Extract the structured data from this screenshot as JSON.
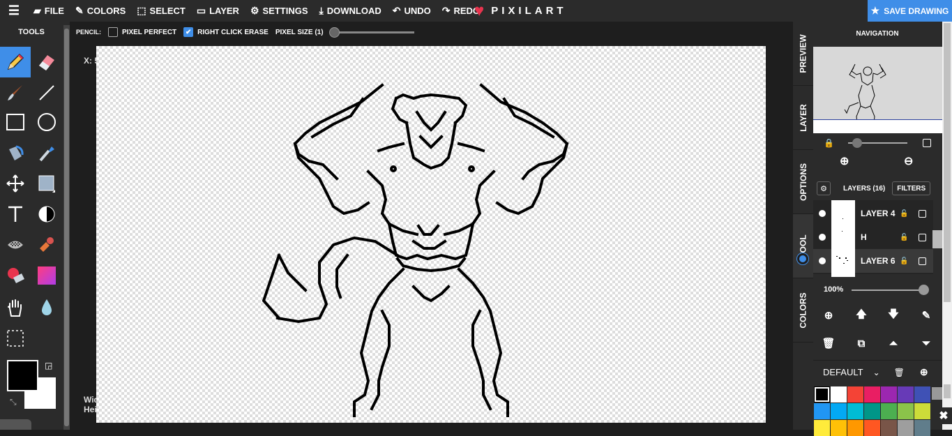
{
  "app": {
    "brand": "PIXILART",
    "menu": [
      {
        "label": "FILE",
        "icon": "file-icon"
      },
      {
        "label": "COLORS",
        "icon": "brush-icon"
      },
      {
        "label": "SELECT",
        "icon": "select-icon"
      },
      {
        "label": "LAYER",
        "icon": "layer-icon"
      },
      {
        "label": "SETTINGS",
        "icon": "gear-icon"
      },
      {
        "label": "DOWNLOAD",
        "icon": "download-icon"
      },
      {
        "label": "UNDO",
        "icon": "undo-icon"
      },
      {
        "label": "REDO",
        "icon": "redo-icon"
      }
    ],
    "save_label": "SAVE DRAWING"
  },
  "tools": {
    "title": "TOOLS",
    "items": [
      "pencil",
      "eraser",
      "brush",
      "line",
      "rectangle",
      "circle",
      "bucket",
      "eyedropper",
      "move",
      "shape-select",
      "text",
      "dither",
      "pattern",
      "stamp",
      "color-replace",
      "gradient",
      "hand",
      "drop",
      "selection"
    ],
    "active": "pencil",
    "primary_color": "#000000",
    "secondary_color": "#ffffff"
  },
  "options": {
    "tool_label": "PENCIL:",
    "pixel_perfect": {
      "label": "PIXEL PERFECT",
      "checked": false
    },
    "right_click_erase": {
      "label": "RIGHT CLICK ERASE",
      "checked": true
    },
    "pixel_size": {
      "label": "PIXEL SIZE (1)",
      "value": 1
    }
  },
  "workspace": {
    "coords_label": "X: 5",
    "dims_line1": "Wid",
    "dims_line2": "Hei"
  },
  "side_tabs": [
    "PREVIEW",
    "LAYER",
    "OPTIONS",
    "TOOL",
    "COLORS"
  ],
  "active_side_tab": "TOOL",
  "navigation": {
    "title": "NAVIGATION"
  },
  "layers": {
    "count_label": "LAYERS (16)",
    "filters_label": "FILTERS",
    "items": [
      {
        "name": "LAYER 4",
        "selected": false
      },
      {
        "name": "H",
        "selected": false
      },
      {
        "name": "LAYER 6",
        "selected": true
      }
    ],
    "opacity": "100%"
  },
  "palette": {
    "name": "DEFAULT",
    "colors": [
      "#000000",
      "#ffffff",
      "#f44336",
      "#e91e63",
      "#9c27b0",
      "#673ab7",
      "#3f51b5",
      "#2196f3",
      "#03a9f4",
      "#00bcd4",
      "#009688",
      "#4caf50",
      "#8bc34a",
      "#cddc39",
      "#ffeb3b",
      "#ffc107",
      "#ff9800",
      "#ff5722",
      "#795548",
      "#9e9e9e",
      "#607d8b"
    ]
  }
}
